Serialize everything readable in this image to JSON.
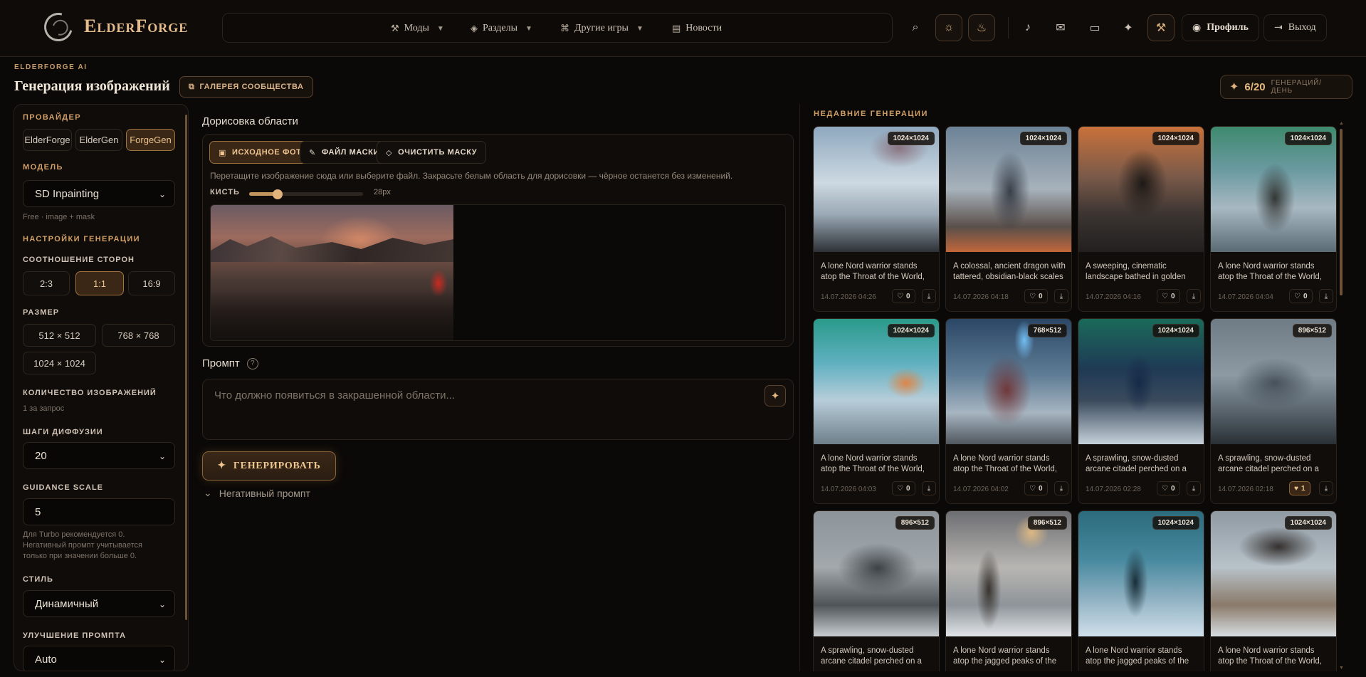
{
  "brand": {
    "name": "ElderForge"
  },
  "nav": {
    "items": [
      {
        "label": "Моды",
        "icon": "hammer-icon",
        "has_menu": true
      },
      {
        "label": "Разделы",
        "icon": "layers-icon",
        "has_menu": true
      },
      {
        "label": "Другие игры",
        "icon": "gamepad-icon",
        "has_menu": true
      },
      {
        "label": "Новости",
        "icon": "newspaper-icon",
        "has_menu": false
      }
    ],
    "profile_label": "Профиль",
    "logout_label": "Выход"
  },
  "header": {
    "eyebrow": "ELDERFORGE AI",
    "title": "Генерация изображений",
    "gallery_button": "ГАЛЕРЕЯ СООБЩЕСТВА",
    "quota_count": "6/20",
    "quota_unit": "ГЕНЕРАЦИЙ/ДЕНЬ"
  },
  "sidebar": {
    "provider_title": "ПРОВАЙДЕР",
    "providers": [
      "ElderForge",
      "ElderGen",
      "ForgeGen"
    ],
    "provider_selected": "ForgeGen",
    "model_title": "МОДЕЛЬ",
    "model_value": "SD Inpainting",
    "model_hint": "Free · image + mask",
    "settings_title": "НАСТРОЙКИ ГЕНЕРАЦИИ",
    "aspect_label": "СООТНОШЕНИЕ СТОРОН",
    "aspects": [
      "2:3",
      "1:1",
      "16:9"
    ],
    "aspect_selected": "1:1",
    "size_label": "РАЗМЕР",
    "sizes": [
      "512 × 512",
      "768 × 768",
      "1024 × 1024"
    ],
    "count_label": "КОЛИЧЕСТВО ИЗОБРАЖЕНИЙ",
    "count_hint": "1 за запрос",
    "steps_label": "ШАГИ ДИФФУЗИИ",
    "steps_value": "20",
    "guidance_label": "GUIDANCE SCALE",
    "guidance_value": "5",
    "guidance_hint": "Для Turbo рекомендуется 0. Негативный промпт учитывается только при значении больше 0.",
    "style_label": "СТИЛЬ",
    "style_value": "Динамичный",
    "enhance_label": "УЛУЧШЕНИЕ ПРОМПТА",
    "enhance_value": "Auto"
  },
  "editor": {
    "title": "Дорисовка области",
    "buttons": [
      "ИСХОДНОЕ ФОТО",
      "ФАЙЛ МАСКИ",
      "ОЧИСТИТЬ МАСКУ"
    ],
    "active_button": "ИСХОДНОЕ ФОТО",
    "hint": "Перетащите изображение сюда или выберите файл. Закрасьте белым область для дорисовки — чёрное останется без изменений.",
    "brush_label": "КИСТЬ",
    "brush_value": "28px",
    "brush_fraction": 0.25
  },
  "prompt": {
    "label": "Промпт",
    "placeholder": "Что должно появиться в закрашенной области...",
    "generate_label": "ГЕНЕРИРОВАТЬ",
    "negative_label": "Негативный промпт"
  },
  "recent": {
    "title": "НЕДАВНИЕ ГЕНЕРАЦИИ",
    "cards": [
      {
        "res": "1024×1024",
        "caption": "A lone Nord warrior stands atop the Throat of the World, gazing",
        "date": "14.07.2026 04:26",
        "likes": "0",
        "liked": false
      },
      {
        "res": "1024×1024",
        "caption": "A colossal, ancient dragon with tattered, obsidian-black scales",
        "date": "14.07.2026 04:18",
        "likes": "0",
        "liked": false
      },
      {
        "res": "1024×1024",
        "caption": "A sweeping, cinematic landscape bathed in golden light",
        "date": "14.07.2026 04:16",
        "likes": "0",
        "liked": false
      },
      {
        "res": "1024×1024",
        "caption": "A lone Nord warrior stands atop the Throat of the World, gazing",
        "date": "14.07.2026 04:04",
        "likes": "0",
        "liked": false
      },
      {
        "res": "1024×1024",
        "caption": "A lone Nord warrior stands atop the Throat of the World, gazing",
        "date": "14.07.2026 04:03",
        "likes": "0",
        "liked": false
      },
      {
        "res": "768×512",
        "caption": "A lone Nord warrior stands atop the Throat of the World, gazing",
        "date": "14.07.2026 04:02",
        "likes": "0",
        "liked": false
      },
      {
        "res": "1024×1024",
        "caption": "A sprawling, snow-dusted arcane citadel perched on a cliff",
        "date": "14.07.2026 02:28",
        "likes": "0",
        "liked": false
      },
      {
        "res": "896×512",
        "caption": "A sprawling, snow-dusted arcane citadel perched on a cliff",
        "date": "14.07.2026 02:18",
        "likes": "1",
        "liked": true
      },
      {
        "res": "896×512",
        "caption": "A sprawling, snow-dusted arcane citadel perched on a cliff",
        "date": "",
        "likes": "",
        "liked": false
      },
      {
        "res": "896×512",
        "caption": "A lone Nord warrior stands atop the jagged peaks of the mountains",
        "date": "",
        "likes": "",
        "liked": false
      },
      {
        "res": "1024×1024",
        "caption": "A lone Nord warrior stands atop the jagged peaks of the mountains",
        "date": "",
        "likes": "",
        "liked": false
      },
      {
        "res": "1024×1024",
        "caption": "A lone Nord warrior stands atop the Throat of the World, gazing",
        "date": "",
        "likes": "",
        "liked": false
      }
    ]
  },
  "colors": {
    "accent": "#d19f66",
    "background": "#0b0908",
    "panel": "#0f0c0a",
    "active_chip": "#3a2716"
  }
}
